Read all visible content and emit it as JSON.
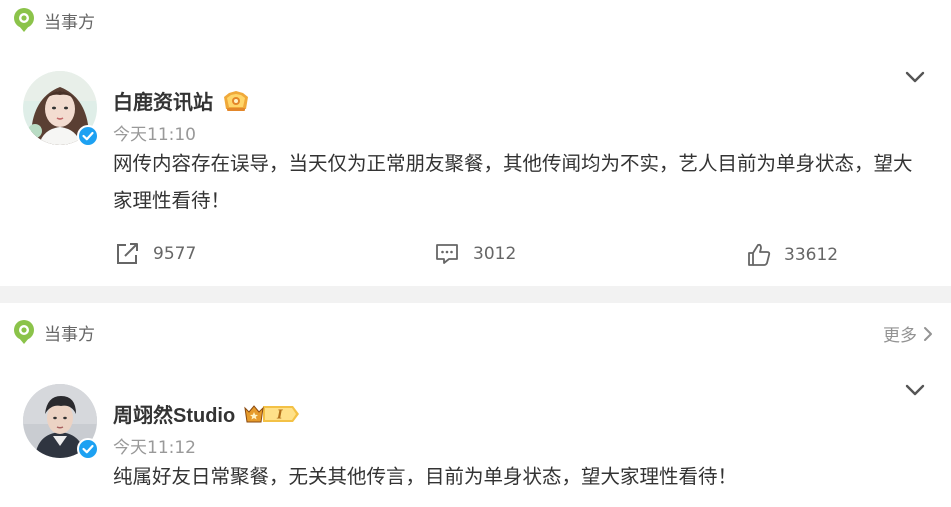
{
  "posts": [
    {
      "source_label": "当事方",
      "author": "白鹿资讯站",
      "time": "今天11:10",
      "content": "网传内容存在误导，当天仅为正常朋友聚餐，其他传闻均为不实，艺人目前为单身状态，望大家理性看待！",
      "shares": "9577",
      "comments": "3012",
      "likes": "33612"
    },
    {
      "source_label": "当事方",
      "more_label": "更多",
      "author": "周翊然Studio",
      "time": "今天11:12",
      "content": "纯属好友日常聚餐，无关其他传言，目前为单身状态，望大家理性看待！"
    }
  ],
  "colors": {
    "source_pin": "#8bc34a",
    "verified": "#1da1f2",
    "separator": "#f2f2f2"
  }
}
